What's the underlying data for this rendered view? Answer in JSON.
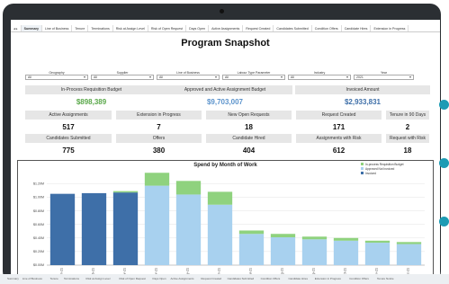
{
  "tabs": [
    "Summary",
    "Line of Business",
    "Tenure",
    "Terminations",
    "Risk at Assign Level",
    "Risk of Open Request",
    "Days Open",
    "Active Assignments",
    "Request Created",
    "Candidates Submitted",
    "Condition Offers",
    "Candidate Hires",
    "Extension in Progress"
  ],
  "active_tab": 0,
  "title": "Program Snapshot",
  "filters": [
    {
      "label": "Geography",
      "value": "All"
    },
    {
      "label": "Supplier",
      "value": "All"
    },
    {
      "label": "Line of Business",
      "value": "All"
    },
    {
      "label": "Labour Type Parameter",
      "value": "All"
    },
    {
      "label": "Industry",
      "value": "All"
    },
    {
      "label": "Year",
      "value": "2021"
    }
  ],
  "budgets": [
    {
      "label": "In-Process Requisition Budget",
      "value": "$898,389",
      "color": "#5aa84a"
    },
    {
      "label": "Approved and Active Assignment Budget",
      "value": "$9,703,007",
      "color": "#5b93cc"
    },
    {
      "label": "Invoiced Amount",
      "value": "$2,933,831",
      "color": "#3e6fa8"
    }
  ],
  "metrics_row1": [
    {
      "label": "Active Assignments",
      "value": "517"
    },
    {
      "label": "Extension in Progress",
      "value": "7"
    },
    {
      "label": "New Open Requests",
      "value": "18"
    },
    {
      "label": "Request Created",
      "value": "171"
    },
    {
      "label": "Tenure in 90 Days",
      "value": "2"
    }
  ],
  "metrics_row2": [
    {
      "label": "Candidates Submitted",
      "value": "775"
    },
    {
      "label": "Offers",
      "value": "380"
    },
    {
      "label": "Candidate Hired",
      "value": "404"
    },
    {
      "label": "Assignments with Risk",
      "value": "612"
    },
    {
      "label": "Request with Risk",
      "value": "18"
    }
  ],
  "bottom_tabs": [
    "Summary",
    "Line of Business",
    "Tenure",
    "Terminations",
    "Risk at Assign Level",
    "Risk of Open Request",
    "Days Open",
    "Active Assignments",
    "Request Created",
    "Candidates Submitted",
    "Condition Offers",
    "Candidate Hires",
    "Extension in Progress",
    "Condition Offers",
    "Tenure Notice"
  ],
  "chart_data": {
    "type": "bar",
    "title": "Spend by Month of Work",
    "categories": [
      "Jan-21",
      "Feb-21",
      "Mar-21",
      "Apr-21",
      "May-21",
      "Jun-21",
      "Jul-21",
      "Aug-21",
      "Sep-21",
      "Oct-21",
      "Nov-21",
      "Dec-21"
    ],
    "series": [
      {
        "name": "Invoiced",
        "color": "#3e6fa8",
        "values": [
          1.05,
          1.06,
          1.07,
          0,
          0,
          0,
          0,
          0,
          0,
          0,
          0,
          0
        ]
      },
      {
        "name": "Approved Not Invoiced",
        "color": "#a8d1ef",
        "values": [
          0,
          0,
          0,
          1.17,
          1.04,
          0.89,
          0.46,
          0.41,
          0.38,
          0.36,
          0.33,
          0.31
        ]
      },
      {
        "name": "In-process Requisition Budget",
        "color": "#8fd27e",
        "values": [
          0,
          0,
          0.02,
          0.19,
          0.2,
          0.19,
          0.05,
          0.05,
          0.04,
          0.04,
          0.03,
          0.03
        ]
      }
    ],
    "yticks": [
      "$0.00M",
      "$0.20M",
      "$0.40M",
      "$0.60M",
      "$0.80M",
      "$1.00M",
      "$1.20M"
    ],
    "ylim": [
      0,
      1.35
    ],
    "legend_position": "top-right"
  }
}
